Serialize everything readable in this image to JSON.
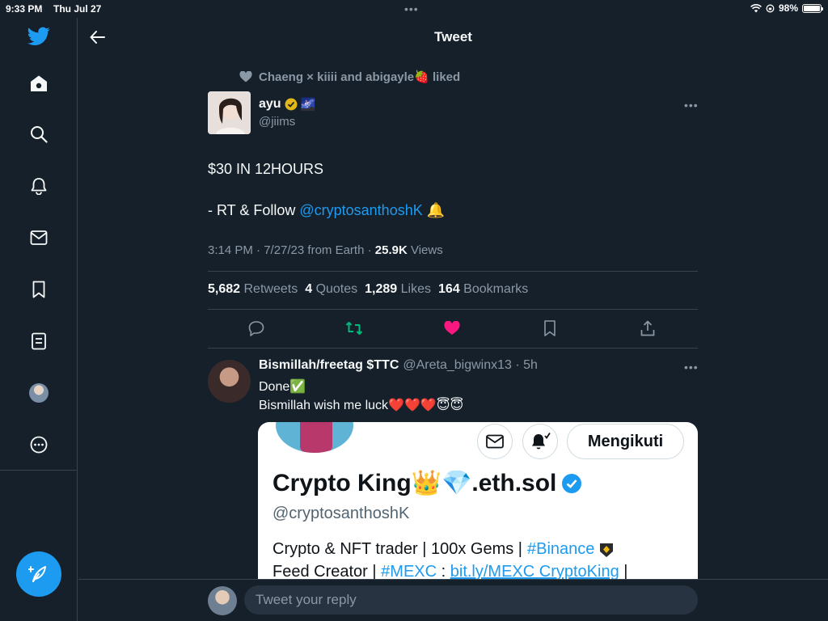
{
  "status_bar": {
    "time": "9:33 PM",
    "date": "Thu Jul 27",
    "battery_text": "98%",
    "battery_level": 0.98
  },
  "sidebar": {
    "items": [
      {
        "icon": "twitter-logo-icon"
      },
      {
        "icon": "home-icon"
      },
      {
        "icon": "search-icon"
      },
      {
        "icon": "bell-icon"
      },
      {
        "icon": "mail-icon"
      },
      {
        "icon": "bookmark-icon"
      },
      {
        "icon": "lists-icon"
      },
      {
        "icon": "profile-avatar"
      },
      {
        "icon": "more-icon"
      }
    ],
    "compose_icon": "compose-feather-icon"
  },
  "header": {
    "title": "Tweet"
  },
  "tweet": {
    "social_context": "Chaeng × kiiii and abigayle🍓 liked",
    "author_name": "ayu",
    "author_emoji": "🌌",
    "author_handle": "@jiims",
    "text_line1": "$30 IN 12HOURS",
    "text_line2_prefix": "- RT & Follow ",
    "text_line2_link": "@cryptosanthoshK",
    "text_line2_suffix": " 🔔",
    "meta_prefix": "3:14 PM · 7/27/23 from Earth · ",
    "views_count": "25.9K",
    "views_label": "Views",
    "stats": {
      "retweets_count": "5,682",
      "retweets_label": "Retweets",
      "quotes_count": "4",
      "quotes_label": "Quotes",
      "likes_count": "1,289",
      "likes_label": "Likes",
      "bookmarks_count": "164",
      "bookmarks_label": "Bookmarks"
    },
    "colors": {
      "retweet": "#00ba7c",
      "like": "#f91880",
      "link": "#1d9bf0"
    }
  },
  "reply": {
    "name": "Bismillah/freetag $TTC",
    "handle_time": "@Areta_bigwinx13 · 5h",
    "line1": "Done✅",
    "line2": "Bismillah wish me luck❤️❤️❤️😇😇"
  },
  "card": {
    "follow_label": "Mengikuti",
    "name": "Crypto King👑💎.eth.sol",
    "handle": "@cryptosanthoshK",
    "bio1_text": "Crypto & NFT trader | 100x Gems |",
    "bio1_tag": "#Binance",
    "bio2_text": "Feed Creator |",
    "bio2_tag": "#MEXC",
    "bio2_sep": ":",
    "bio2_link": "bit.ly/MEXC CryptoKing",
    "bio2_end": "|"
  },
  "reply_bar": {
    "placeholder": "Tweet your reply"
  }
}
